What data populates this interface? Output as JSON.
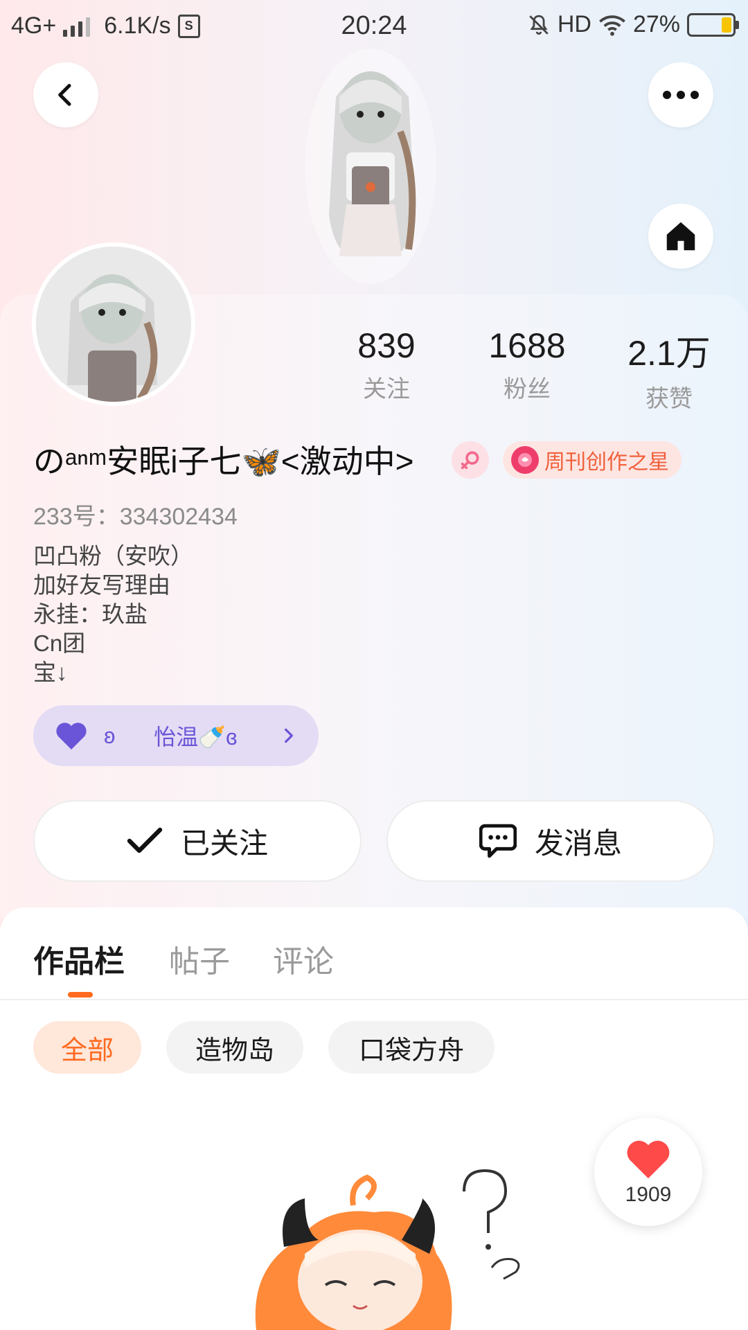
{
  "status_bar": {
    "network": "4G+",
    "speed": "6.1K/s",
    "time": "20:24",
    "hd": "HD",
    "battery_percent": "27%",
    "battery_level": 0.27
  },
  "header": {
    "back_icon": "chevron-left-icon",
    "more_icon": "more-dots-icon",
    "home_icon": "home-icon"
  },
  "profile": {
    "stats": [
      {
        "value": "839",
        "label": "关注"
      },
      {
        "value": "1688",
        "label": "粉丝"
      },
      {
        "value": "2.1万",
        "label": "获赞"
      }
    ],
    "username": "のᵃⁿᵐ安眠i子七🦋<激动中>",
    "gender_icon": "female-icon",
    "award_label": "周刊创作之星",
    "uid": "233号：334302434",
    "bio": [
      "凹凸粉（安吹）",
      "加好友写理由",
      "永挂：玖盐",
      "Cn团",
      "宝↓"
    ],
    "relation": {
      "left_text": "ʚ",
      "right_text": "怡温🍼ɞ"
    }
  },
  "actions": {
    "follow_label": "已关注",
    "message_label": "发消息"
  },
  "tabs": [
    {
      "label": "作品栏",
      "active": true
    },
    {
      "label": "帖子",
      "active": false
    },
    {
      "label": "评论",
      "active": false
    }
  ],
  "filters": [
    {
      "label": "全部",
      "active": true
    },
    {
      "label": "造物岛",
      "active": false
    },
    {
      "label": "口袋方舟",
      "active": false
    }
  ],
  "like_float": {
    "count": "1909"
  },
  "colors": {
    "accent": "#ff6a1f",
    "relation_text": "#6a55d8",
    "award_text": "#f0603a"
  }
}
